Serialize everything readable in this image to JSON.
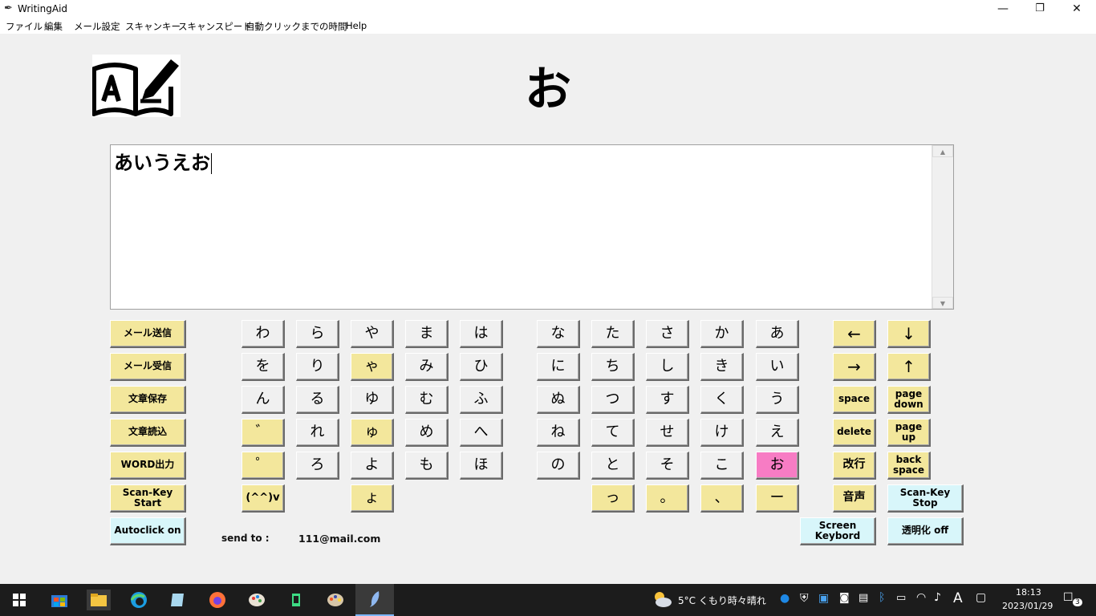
{
  "window": {
    "title": "WritingAid",
    "minimize": "—",
    "maximize": "❐",
    "close": "✕"
  },
  "menu": [
    "ファイル",
    "編集",
    "メール設定",
    "スキャンキー",
    "スキャンスピード",
    "自動クリックまでの時間",
    "Help"
  ],
  "current_char": "お",
  "editor": {
    "text": "あいうえお"
  },
  "left_buttons": {
    "mail_send": "メール送信",
    "mail_receive": "メール受信",
    "save_text": "文章保存",
    "load_text": "文章読込",
    "word_export": "WORD出力",
    "scan_key_start": "Scan-Key Start",
    "autoclick": "Autoclick on"
  },
  "kana": {
    "col_wa": [
      "わ",
      "を",
      "ん",
      "゛",
      "゜",
      "(^^)v"
    ],
    "col_ra": [
      "ら",
      "り",
      "る",
      "れ",
      "ろ"
    ],
    "col_ya": [
      "や",
      "ゃ",
      "ゆ",
      "ゅ",
      "よ",
      "ょ"
    ],
    "col_ma": [
      "ま",
      "み",
      "む",
      "め",
      "も"
    ],
    "col_ha": [
      "は",
      "ひ",
      "ふ",
      "へ",
      "ほ"
    ],
    "col_na": [
      "な",
      "に",
      "ぬ",
      "ね",
      "の"
    ],
    "col_ta": [
      "た",
      "ち",
      "つ",
      "て",
      "と",
      "っ"
    ],
    "col_sa": [
      "さ",
      "し",
      "す",
      "せ",
      "そ",
      "。"
    ],
    "col_ka": [
      "か",
      "き",
      "く",
      "け",
      "こ",
      "、"
    ],
    "col_a": [
      "あ",
      "い",
      "う",
      "え",
      "お",
      "ー"
    ]
  },
  "controls": {
    "left_arrow": "←",
    "down_arrow": "↓",
    "right_arrow": "→",
    "up_arrow": "↑",
    "space": "space",
    "page_down": "page down",
    "delete": "delete",
    "page_up": "page up",
    "newline": "改行",
    "backspace": "back space",
    "voice": "音声",
    "scan_key_stop": "Scan-Key Stop",
    "screen_keyboard": "Screen Keybord",
    "transparency": "透明化 off"
  },
  "send_to": {
    "label": "send to :",
    "address": "111@mail.com"
  },
  "taskbar": {
    "weather": "5°C くもり時々晴れ",
    "ime": "A",
    "time": "18:13",
    "date": "2023/01/29",
    "notifications": "3"
  },
  "colors": {
    "highlight_key": "#f77cc4",
    "yellow_key": "#f3e79c",
    "cyan_key": "#d8f6fa",
    "gray_key": "#f0f0f0",
    "taskbar": "#1c1c1c"
  }
}
